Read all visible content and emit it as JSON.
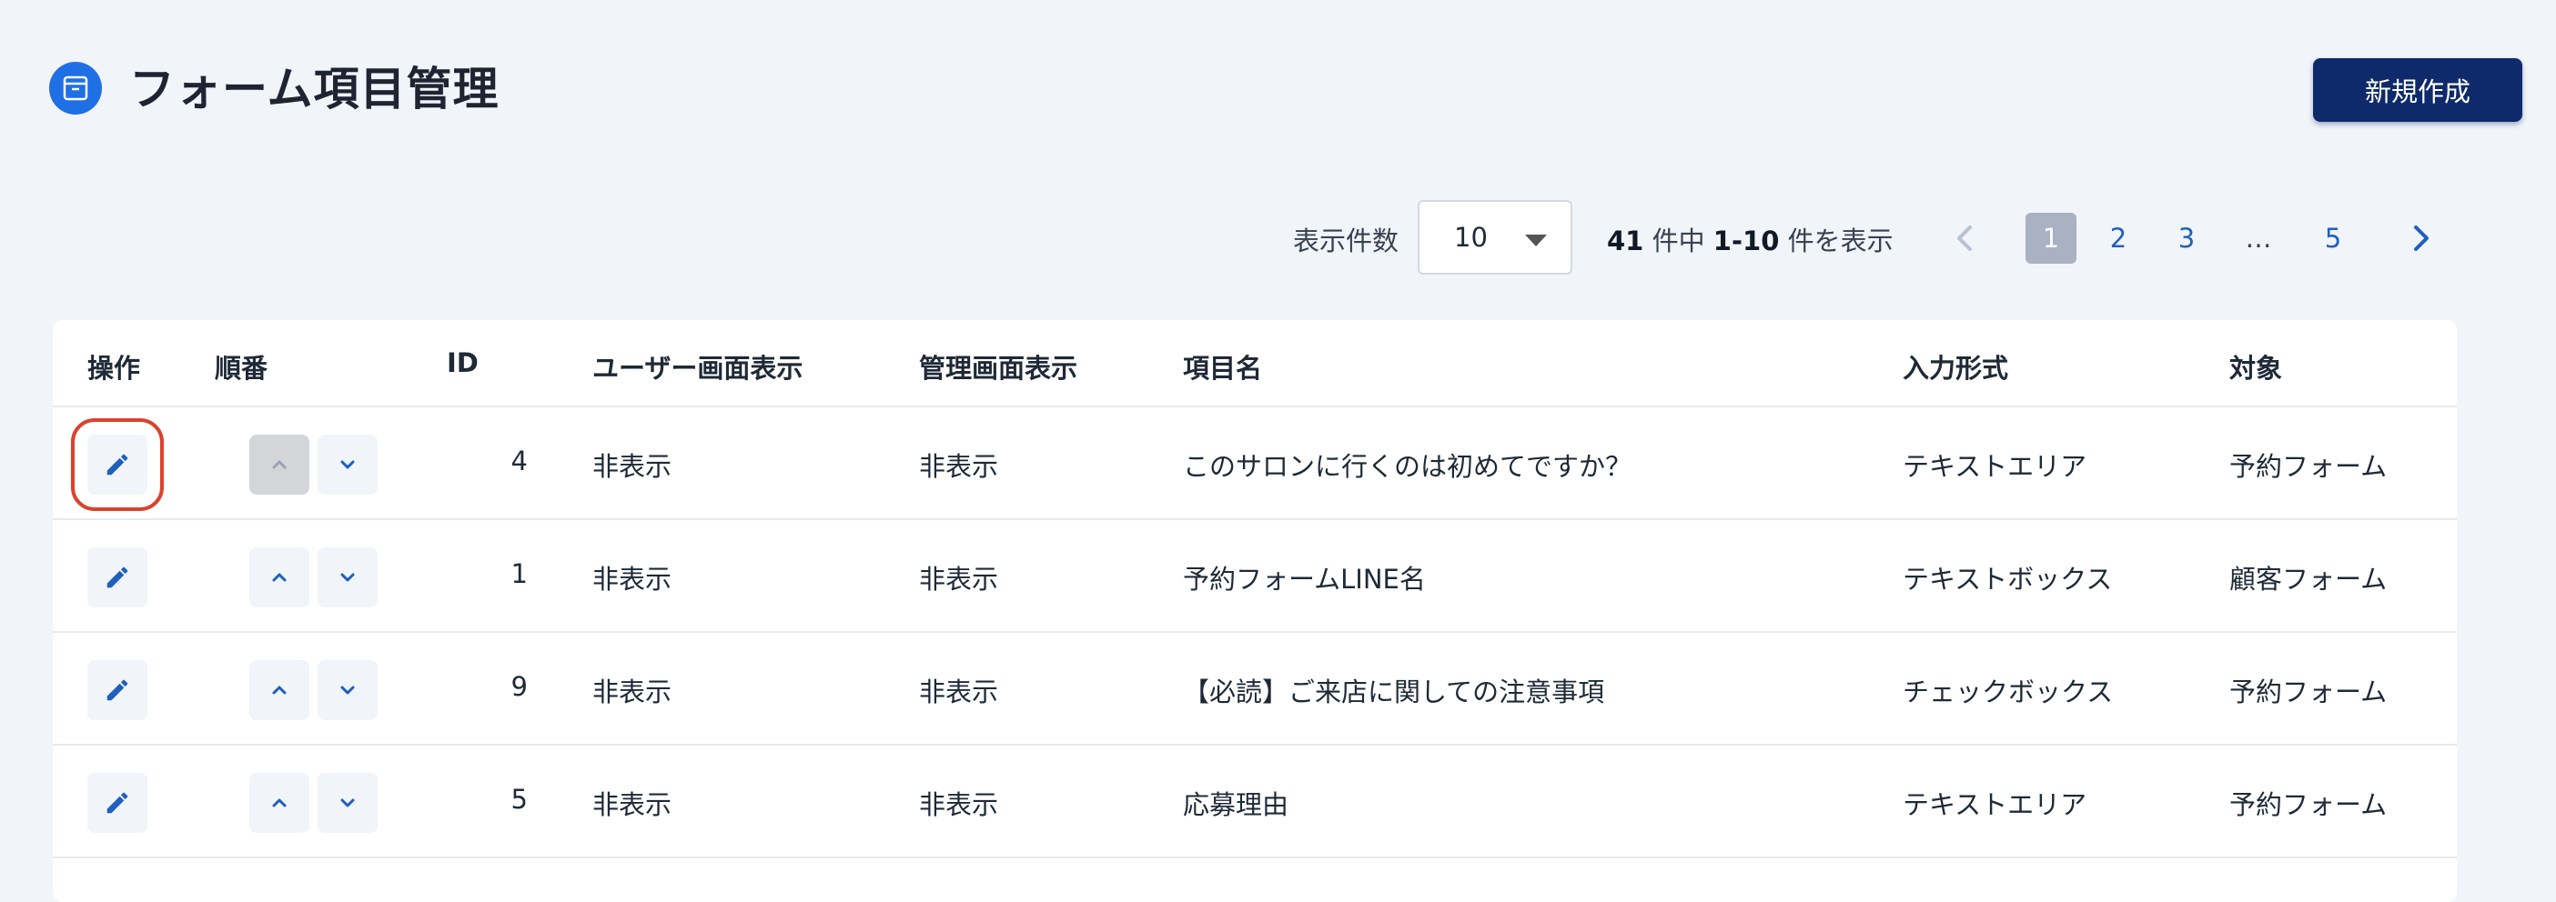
{
  "header": {
    "title": "フォーム項目管理",
    "new_button": "新規作成"
  },
  "toolbar": {
    "per_page_label": "表示件数",
    "per_page_value": "10",
    "summary": {
      "total": "41",
      "of_label": " 件中 ",
      "range": "1-10",
      "suffix": " 件を表示"
    },
    "pages": [
      "1",
      "2",
      "3",
      "…",
      "5"
    ],
    "current_page": "1"
  },
  "table": {
    "columns": [
      "操作",
      "順番",
      "ID",
      "ユーザー画面表示",
      "管理画面表示",
      "項目名",
      "入力形式",
      "対象"
    ],
    "rows": [
      {
        "id": "4",
        "user_display": "非表示",
        "admin_display": "非表示",
        "name": "このサロンに行くのは初めてですか？",
        "input_type": "テキストエリア",
        "target": "予約フォーム"
      },
      {
        "id": "1",
        "user_display": "非表示",
        "admin_display": "非表示",
        "name": "予約フォームLINE名",
        "input_type": "テキストボックス",
        "target": "顧客フォーム"
      },
      {
        "id": "9",
        "user_display": "非表示",
        "admin_display": "非表示",
        "name": "【必読】ご来店に関しての注意事項",
        "input_type": "チェックボックス",
        "target": "予約フォーム"
      },
      {
        "id": "5",
        "user_display": "非表示",
        "admin_display": "非表示",
        "name": "応募理由",
        "input_type": "テキストエリア",
        "target": "予約フォーム"
      }
    ]
  },
  "icons": {
    "title": "archive-box-icon",
    "edit": "pencil-icon",
    "up": "chevron-up-icon",
    "down": "chevron-down-icon",
    "prev": "chevron-left-icon",
    "next": "chevron-right-icon"
  },
  "colors": {
    "primary": "#0e2a6b",
    "accent": "#1f6fe5",
    "link": "#1f5fbf",
    "highlight": "#d9432e",
    "background": "#f1f4f8"
  }
}
